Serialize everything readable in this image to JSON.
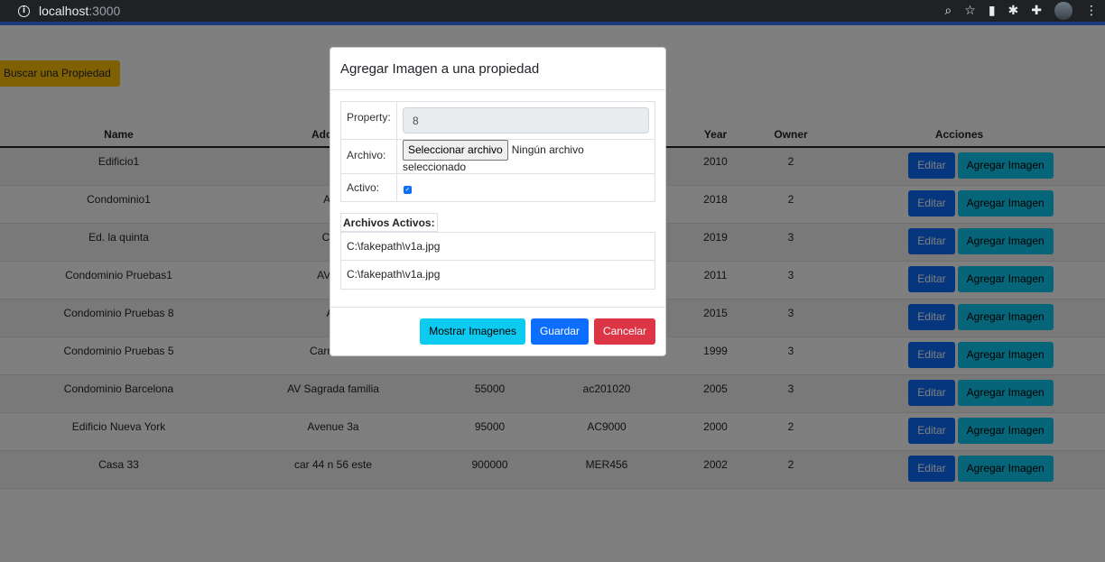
{
  "browser": {
    "url_host": "localhost",
    "url_port": ":3000"
  },
  "page": {
    "search_button": "Buscar una Propiedad"
  },
  "table": {
    "headers": [
      "Name",
      "Address",
      "",
      "",
      "Year",
      "Owner",
      "Acciones"
    ],
    "rows": [
      {
        "name": "Edificio1",
        "address": "C",
        "price": "",
        "code": "",
        "year": "2010",
        "owner": "2"
      },
      {
        "name": "Condominio1",
        "address": "AV1",
        "price": "",
        "code": "",
        "year": "2018",
        "owner": "2"
      },
      {
        "name": "Ed. la quinta",
        "address": "Cl22",
        "price": "",
        "code": "",
        "year": "2019",
        "owner": "3"
      },
      {
        "name": "Condominio Pruebas1",
        "address": "AV Sie",
        "price": "",
        "code": "",
        "year": "2011",
        "owner": "3"
      },
      {
        "name": "Condominio Pruebas 8",
        "address": "AV",
        "price": "",
        "code": "",
        "year": "2015",
        "owner": "3"
      },
      {
        "name": "Condominio Pruebas 5",
        "address": "Carrera S",
        "price": "",
        "code": "",
        "year": "1999",
        "owner": "3"
      },
      {
        "name": "Condominio Barcelona",
        "address": "AV Sagrada familia",
        "price": "55000",
        "code": "ac201020",
        "year": "2005",
        "owner": "3"
      },
      {
        "name": "Edificio Nueva York",
        "address": "Avenue 3a",
        "price": "95000",
        "code": "AC9000",
        "year": "2000",
        "owner": "2"
      },
      {
        "name": "Casa 33",
        "address": "car 44 n 56 este",
        "price": "900000",
        "code": "MER456",
        "year": "2002",
        "owner": "2"
      }
    ],
    "edit_label": "Editar",
    "add_image_label": "Agregar Imagen"
  },
  "modal": {
    "title": "Agregar Imagen a una propiedad",
    "property_label": "Property:",
    "property_value": "8",
    "file_label": "Archivo:",
    "file_button": "Seleccionar archivo",
    "file_status": "Ningún archivo seleccionado",
    "active_label": "Activo:",
    "active_files_heading": "Archivos Activos:",
    "active_files": [
      "C:\\fakepath\\v1a.jpg",
      "C:\\fakepath\\v1a.jpg"
    ],
    "show_images_button": "Mostrar Imagenes",
    "save_button": "Guardar",
    "cancel_button": "Cancelar"
  }
}
